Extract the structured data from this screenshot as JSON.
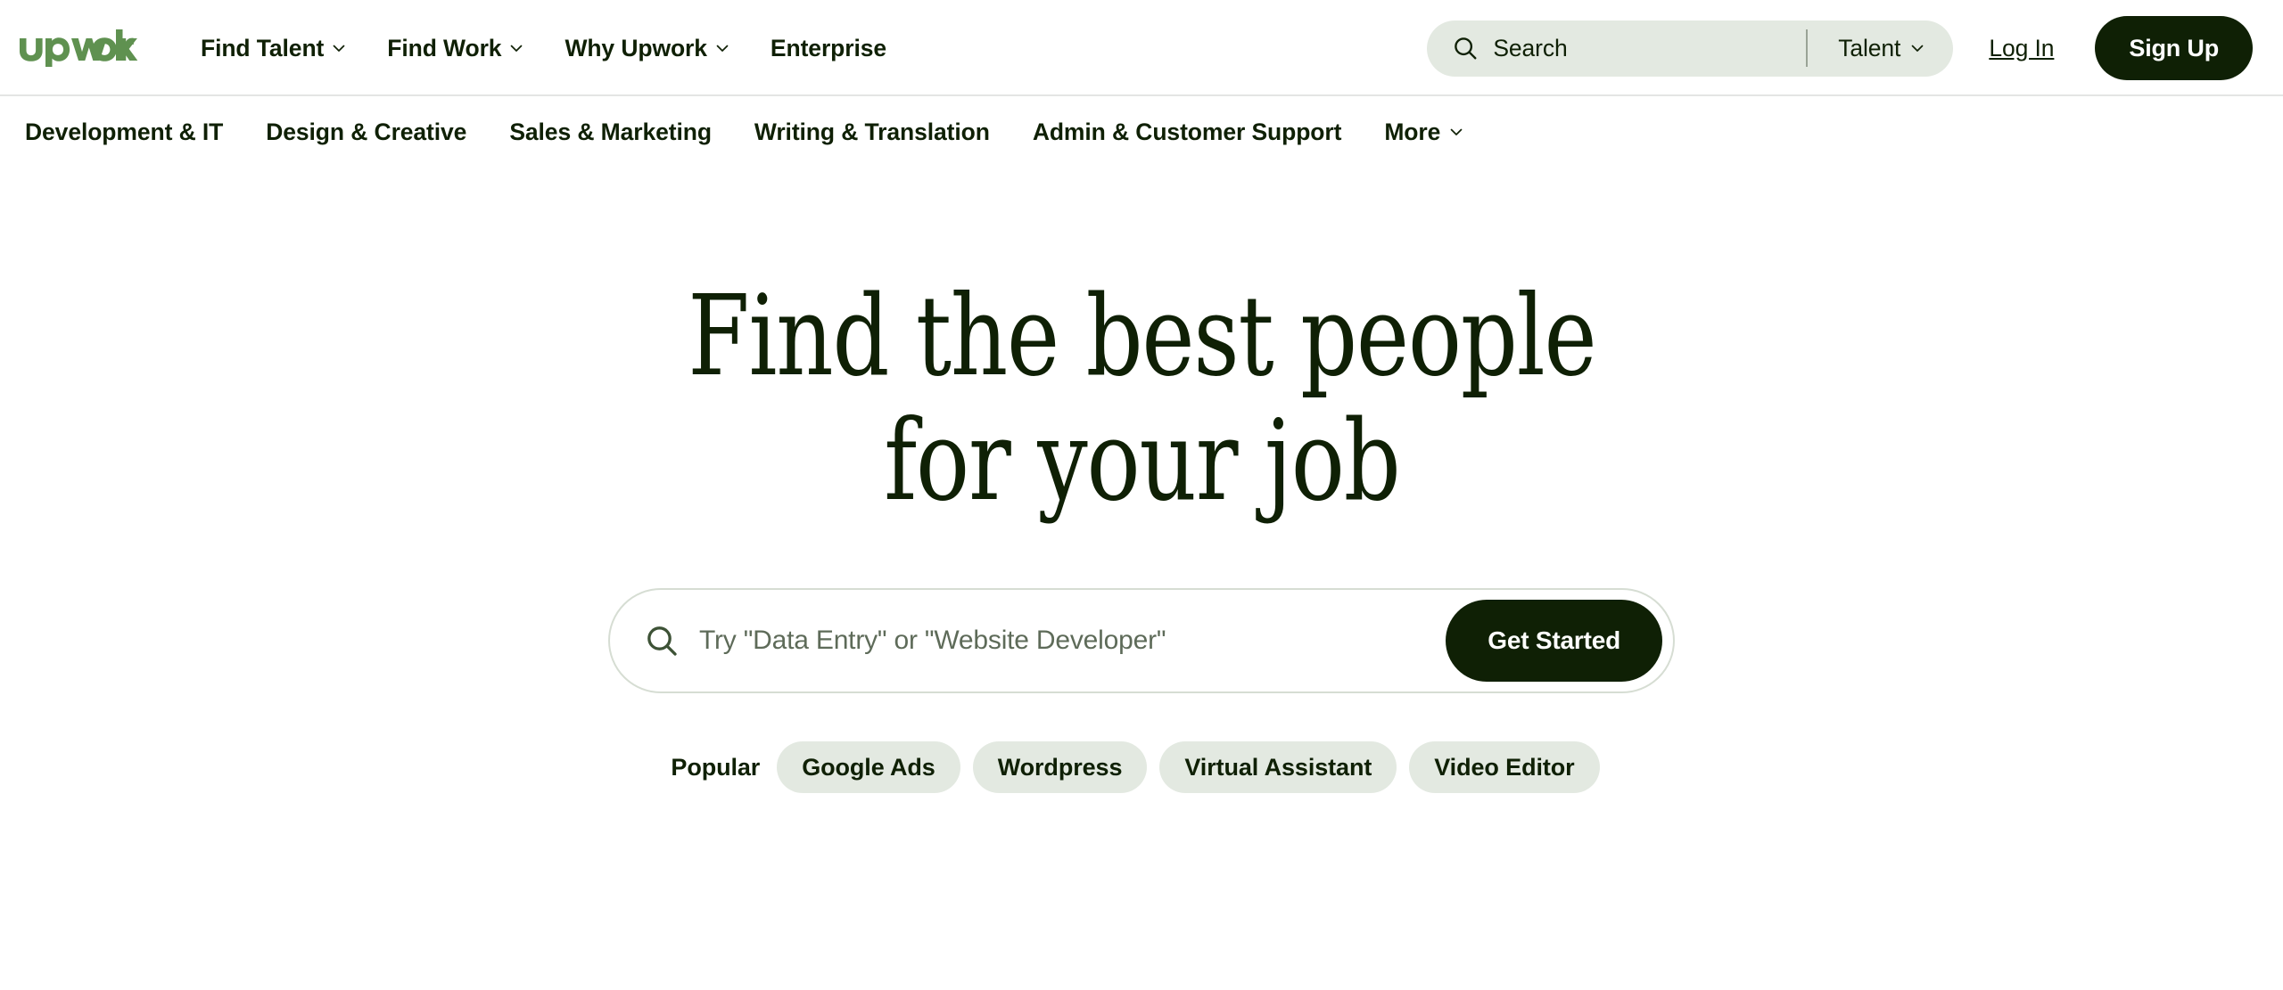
{
  "brand": {
    "logo_text": "upwork",
    "logo_color": "#5f9150",
    "dark_color": "#0f2005",
    "pill_bg": "#e3e9e1"
  },
  "header": {
    "nav": [
      {
        "label": "Find Talent",
        "icon": "chevron-down-icon",
        "has_chevron": true
      },
      {
        "label": "Find Work",
        "icon": "chevron-down-icon",
        "has_chevron": true
      },
      {
        "label": "Why Upwork",
        "icon": "chevron-down-icon",
        "has_chevron": true
      },
      {
        "label": "Enterprise",
        "icon": "",
        "has_chevron": false
      }
    ],
    "search": {
      "icon": "search-icon",
      "placeholder": "Search",
      "value": "",
      "scope_label": "Talent",
      "scope_icon": "chevron-down-icon"
    },
    "log_in_label": "Log In",
    "sign_up_label": "Sign Up"
  },
  "categories": [
    {
      "label": "Development & IT",
      "has_chevron": false
    },
    {
      "label": "Design & Creative",
      "has_chevron": false
    },
    {
      "label": "Sales & Marketing",
      "has_chevron": false
    },
    {
      "label": "Writing & Translation",
      "has_chevron": false
    },
    {
      "label": "Admin & Customer Support",
      "has_chevron": false
    },
    {
      "label": "More",
      "has_chevron": true
    }
  ],
  "hero": {
    "title": "Find the best people\nfor your job",
    "search": {
      "icon": "search-icon",
      "placeholder": "Try \"Data Entry\" or \"Website Developer\"",
      "value": "",
      "button_label": "Get Started"
    },
    "popular": {
      "label": "Popular",
      "tags": [
        {
          "label": "Google Ads"
        },
        {
          "label": "Wordpress"
        },
        {
          "label": "Virtual Assistant"
        },
        {
          "label": "Video Editor"
        }
      ]
    }
  }
}
